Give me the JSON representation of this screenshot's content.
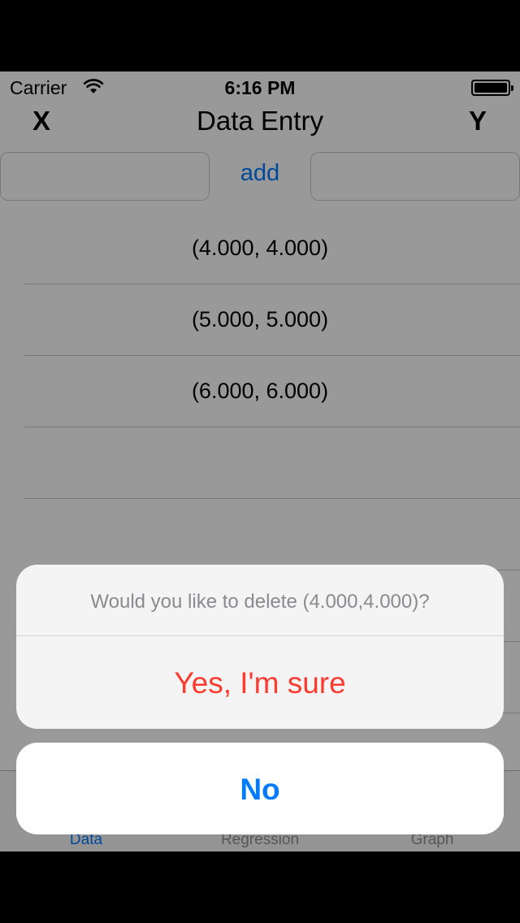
{
  "status_bar": {
    "carrier": "Carrier",
    "time": "6:16 PM"
  },
  "header": {
    "x_label": "X",
    "title": "Data Entry",
    "y_label": "Y"
  },
  "entry": {
    "add_label": "add",
    "x_value": "",
    "y_value": ""
  },
  "rows": [
    "(4.000, 4.000)",
    "(5.000, 5.000)",
    "(6.000, 6.000)",
    "",
    "",
    "",
    ""
  ],
  "tabs": [
    {
      "label": "Data",
      "active": true
    },
    {
      "label": "Regression",
      "active": false
    },
    {
      "label": "Graph",
      "active": false
    }
  ],
  "action_sheet": {
    "message": "Would you like to delete (4.000,4.000)?",
    "confirm_label": "Yes, I'm sure",
    "cancel_label": "No"
  },
  "colors": {
    "accent": "#007aff",
    "destructive": "#ff3b30"
  }
}
